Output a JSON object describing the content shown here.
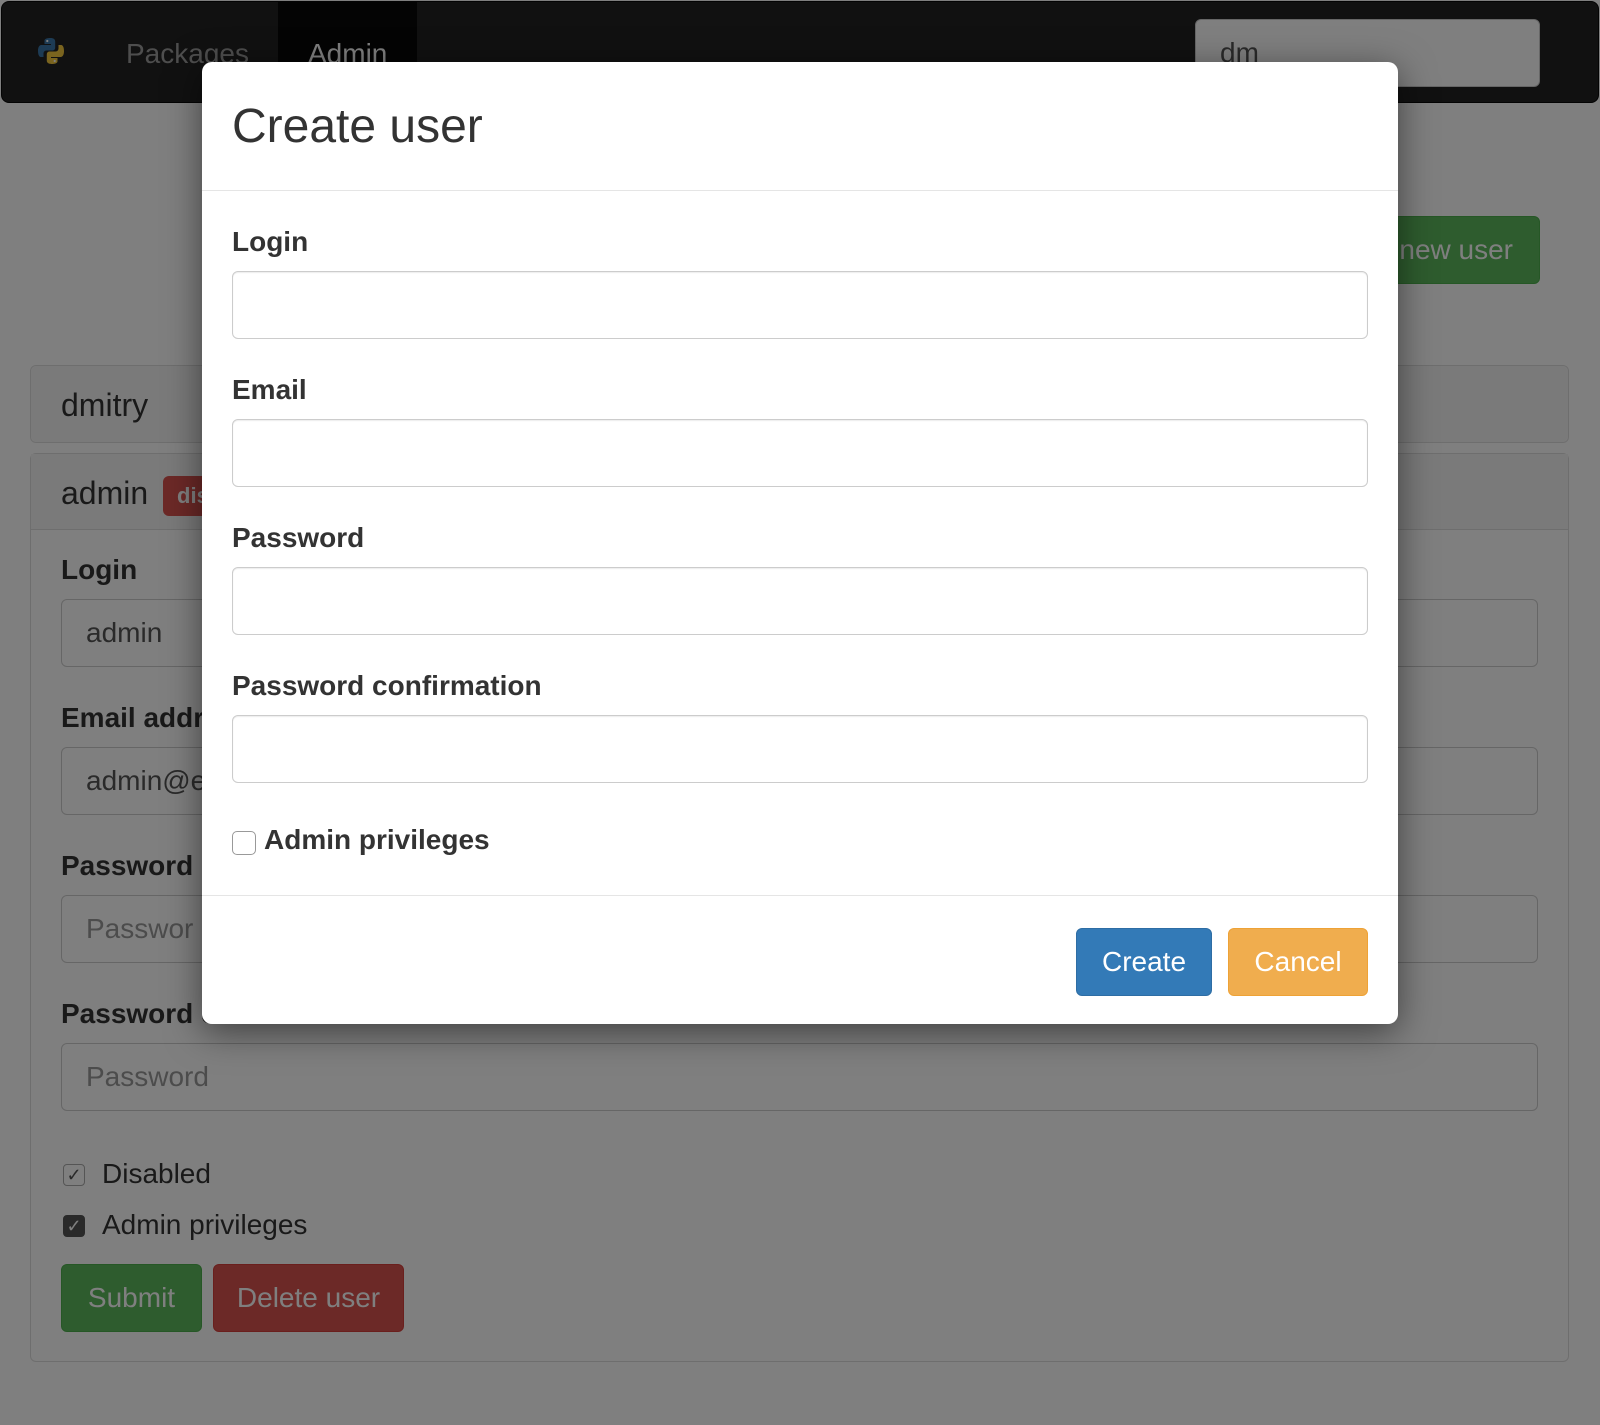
{
  "navbar": {
    "logo_icon": "python-logo-icon",
    "items": [
      {
        "label": "Packages",
        "active": false
      },
      {
        "label": "Admin",
        "active": true
      }
    ],
    "search_value": "dm"
  },
  "page": {
    "new_user_label": "new user",
    "users": [
      {
        "name": "dmitry"
      },
      {
        "name": "admin",
        "badge": "dis"
      }
    ],
    "edit_form": {
      "login_label": "Login",
      "login_value": "admin",
      "email_label": "Email addr",
      "email_value": "admin@e",
      "password_label": "Password",
      "password_placeholder": "Passwor",
      "confirm_label": "Password confirm",
      "confirm_placeholder": "Password",
      "disabled_label": "Disabled",
      "admin_label": "Admin privileges",
      "submit_label": "Submit",
      "delete_label": "Delete user"
    }
  },
  "modal": {
    "title": "Create user",
    "fields": [
      {
        "label": "Login",
        "value": ""
      },
      {
        "label": "Email",
        "value": ""
      },
      {
        "label": "Password",
        "value": ""
      },
      {
        "label": "Password confirmation",
        "value": ""
      }
    ],
    "admin_checkbox_label": "Admin privileges",
    "admin_checked": false,
    "create_label": "Create",
    "cancel_label": "Cancel"
  },
  "colors": {
    "primary": "#337ab7",
    "warning": "#f0ad4e",
    "success": "#5cb85c",
    "danger": "#d9534f",
    "navbar": "#222222"
  }
}
